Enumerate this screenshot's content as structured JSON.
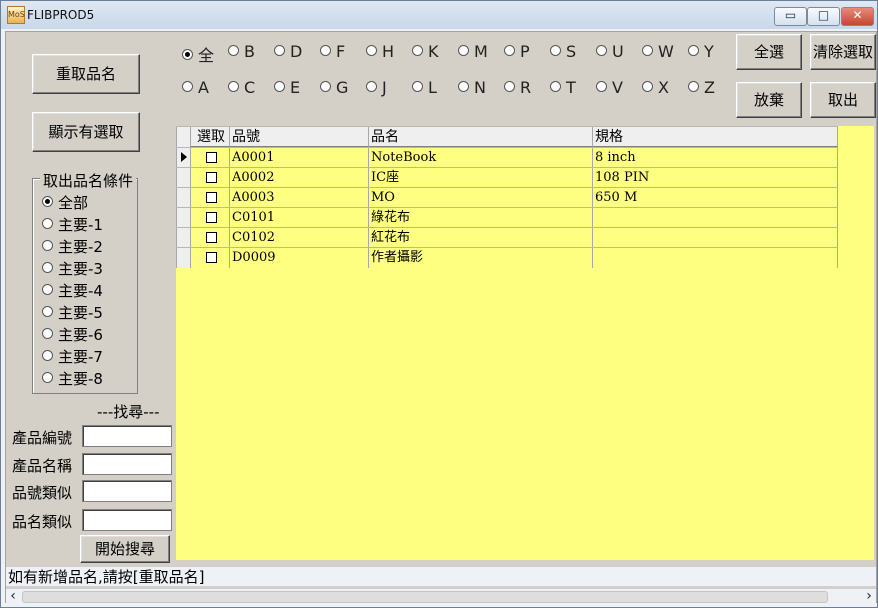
{
  "window": {
    "title": "FLIBPROD5",
    "icon_text": "MoS"
  },
  "left": {
    "reload_button": "重取品名",
    "show_selected_button": "顯示有選取",
    "group_title": "取出品名條件",
    "group_options": [
      "全部",
      "主要-1",
      "主要-2",
      "主要-3",
      "主要-4",
      "主要-5",
      "主要-6",
      "主要-7",
      "主要-8"
    ],
    "selected_option": "全部",
    "find_title": "---找尋---",
    "search_labels": [
      "產品編號",
      "產品名稱",
      "品號類似",
      "品名類似"
    ],
    "search_button": "開始搜尋"
  },
  "top": {
    "letters_row1": [
      "全",
      "B",
      "D",
      "F",
      "H",
      "K",
      "M",
      "P",
      "S",
      "U",
      "W",
      "Y"
    ],
    "letters_row2": [
      "A",
      "C",
      "E",
      "G",
      "J",
      "L",
      "N",
      "R",
      "T",
      "V",
      "X",
      "Z"
    ],
    "selected_letter": "全",
    "select_all": "全選",
    "clear_selection": "清除選取",
    "cancel": "放棄",
    "take_out": "取出"
  },
  "grid": {
    "headers": [
      "選取",
      "品號",
      "品名",
      "規格"
    ],
    "rows": [
      {
        "selected": false,
        "pno": "A0001",
        "name": "NoteBook",
        "spec": "8 inch"
      },
      {
        "selected": false,
        "pno": "A0002",
        "name": "IC座",
        "spec": "108 PIN"
      },
      {
        "selected": false,
        "pno": "A0003",
        "name": "MO",
        "spec": "650 M"
      },
      {
        "selected": false,
        "pno": "C0101",
        "name": "綠花布",
        "spec": ""
      },
      {
        "selected": false,
        "pno": "C0102",
        "name": "紅花布",
        "spec": ""
      },
      {
        "selected": false,
        "pno": "D0009",
        "name": "作者攝影",
        "spec": ""
      }
    ]
  },
  "status": {
    "text": "如有新增品名,請按[重取品名]"
  },
  "scrollbar": {
    "left_arrow": "‹",
    "right_arrow": "›"
  }
}
